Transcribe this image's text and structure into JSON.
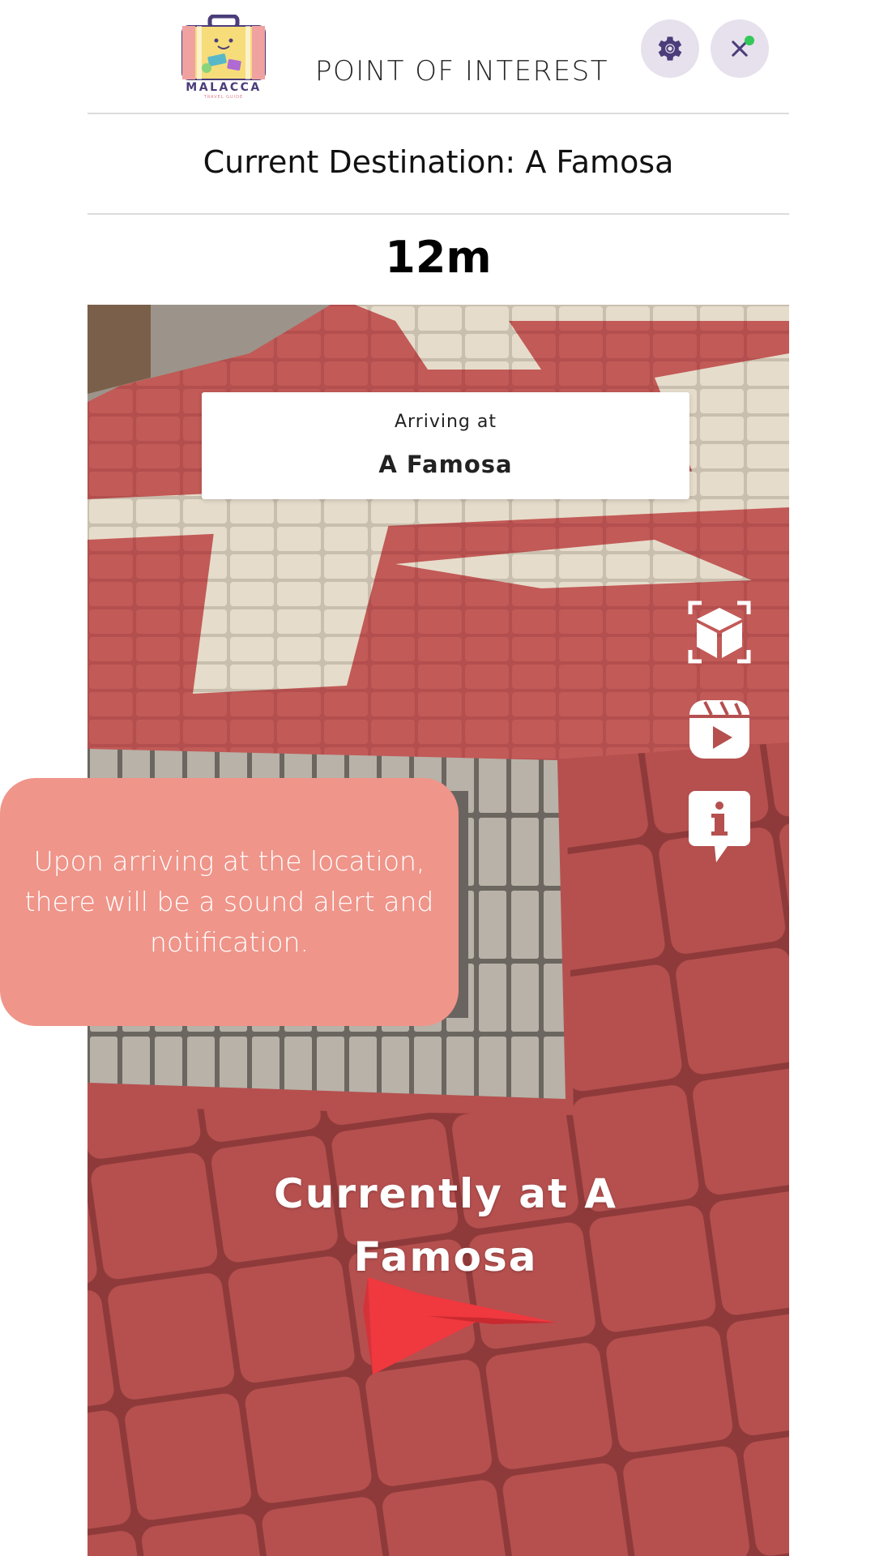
{
  "header": {
    "logo_text": "MALACCA",
    "logo_subtext": "TRAVEL GUIDE",
    "title": "POINT OF INTEREST",
    "settings_icon": "gear-icon",
    "close_icon": "close-icon"
  },
  "destination": {
    "label": "Current Destination: A Famosa",
    "distance": "12m"
  },
  "ar_view": {
    "arrive_label": "Arriving at",
    "arrive_name": "A Famosa",
    "current_status": "Currently at A Famosa",
    "tools": [
      "ar-cube-icon",
      "video-reel-icon",
      "info-bubble-icon"
    ]
  },
  "tooltip": {
    "text": "Upon arriving at the location, there will be a sound alert and notification."
  },
  "colors": {
    "tooltip": "#ef958a",
    "button_bg": "#e6e1ec",
    "icon_purple": "#4b3d7a",
    "status_dot": "#34c759",
    "arrow_red": "#f0383f"
  }
}
